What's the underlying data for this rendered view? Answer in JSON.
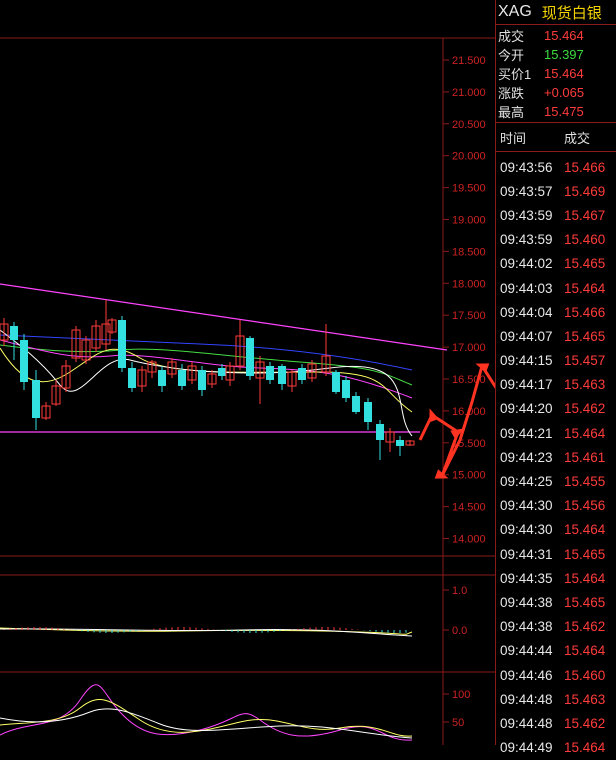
{
  "header": {
    "code": "XAG",
    "name": "现货白银"
  },
  "quotes": [
    {
      "label": "成交",
      "value": "15.464",
      "color": "#ff3b3b"
    },
    {
      "label": "今开",
      "value": "15.397",
      "color": "#3ddc3d"
    },
    {
      "label": "买价1",
      "value": "15.464",
      "color": "#ff3b3b"
    },
    {
      "label": "涨跌",
      "value": "+0.065",
      "color": "#ff3b3b"
    },
    {
      "label": "最高",
      "value": "15.475",
      "color": "#ff3b3b"
    }
  ],
  "ticks_header": {
    "time": "时间",
    "price": "成交"
  },
  "ticks": [
    {
      "time": "09:43:56",
      "price": "15.466"
    },
    {
      "time": "09:43:57",
      "price": "15.469"
    },
    {
      "time": "09:43:59",
      "price": "15.467"
    },
    {
      "time": "09:43:59",
      "price": "15.460"
    },
    {
      "time": "09:44:02",
      "price": "15.465"
    },
    {
      "time": "09:44:03",
      "price": "15.464"
    },
    {
      "time": "09:44:04",
      "price": "15.466"
    },
    {
      "time": "09:44:07",
      "price": "15.465"
    },
    {
      "time": "09:44:15",
      "price": "15.457"
    },
    {
      "time": "09:44:17",
      "price": "15.463"
    },
    {
      "time": "09:44:20",
      "price": "15.462"
    },
    {
      "time": "09:44:21",
      "price": "15.464"
    },
    {
      "time": "09:44:23",
      "price": "15.461"
    },
    {
      "time": "09:44:25",
      "price": "15.455"
    },
    {
      "time": "09:44:30",
      "price": "15.456"
    },
    {
      "time": "09:44:30",
      "price": "15.464"
    },
    {
      "time": "09:44:31",
      "price": "15.465"
    },
    {
      "time": "09:44:35",
      "price": "15.464"
    },
    {
      "time": "09:44:38",
      "price": "15.465"
    },
    {
      "time": "09:44:38",
      "price": "15.462"
    },
    {
      "time": "09:44:44",
      "price": "15.464"
    },
    {
      "time": "09:44:46",
      "price": "15.460"
    },
    {
      "time": "09:44:48",
      "price": "15.463"
    },
    {
      "time": "09:44:48",
      "price": "15.462"
    },
    {
      "time": "09:44:49",
      "price": "15.464"
    }
  ],
  "price_axis": [
    "21.500",
    "21.000",
    "20.500",
    "20.000",
    "19.500",
    "19.000",
    "18.500",
    "18.000",
    "17.500",
    "17.000",
    "16.500",
    "16.000",
    "15.500",
    "15.000",
    "14.500",
    "14.000"
  ],
  "macd_axis": [
    "1.0",
    "0.0"
  ],
  "kdj_axis": [
    "100",
    "50"
  ],
  "colors": {
    "grid": "#8b1a1a",
    "axis_text": "#cc2222",
    "trend_line": "#ff44ff",
    "arrow": "#ff3322",
    "up_candle": "#ff3b3b",
    "down_candle": "#33e0e0"
  }
}
